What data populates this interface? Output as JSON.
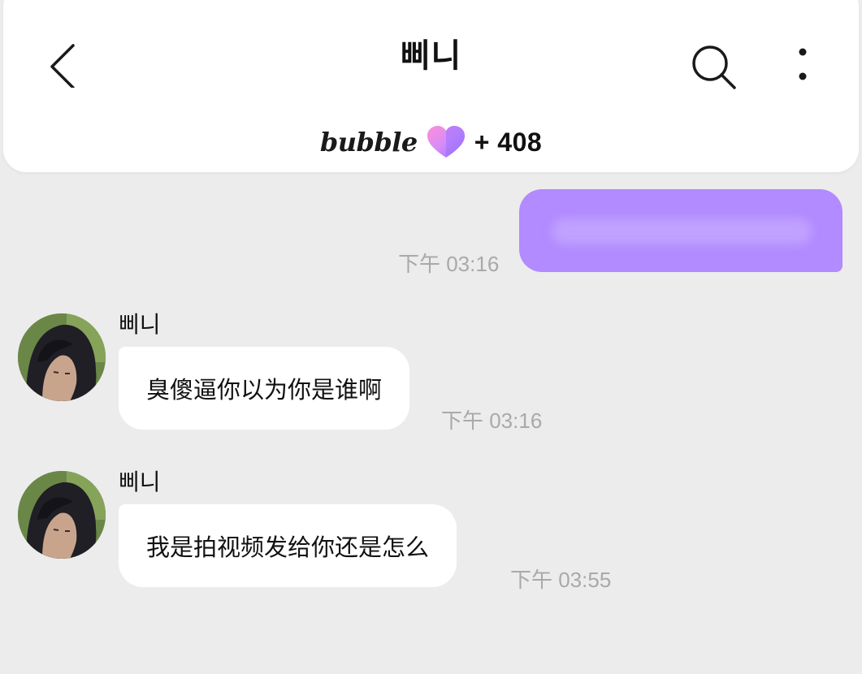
{
  "header": {
    "title": "삐니",
    "brand": "bubble",
    "count": "+ 408",
    "icons": {
      "back": "chevron-left-icon",
      "search": "search-icon",
      "more": "more-vertical-icon",
      "heart": "heart-icon"
    }
  },
  "colors": {
    "sent_bubble": "#b18bff",
    "received_bubble": "#ffffff",
    "background": "#ececec",
    "timestamp": "#a9a9a9"
  },
  "messages": [
    {
      "direction": "sent",
      "text": "",
      "time": "下午 03:16"
    },
    {
      "direction": "received",
      "sender": "삐니",
      "text": "臭傻逼你以为你是谁啊",
      "time": "下午 03:16"
    },
    {
      "direction": "received",
      "sender": "삐니",
      "text": "我是拍视频发给你还是怎么",
      "time": "下午 03:55"
    }
  ]
}
